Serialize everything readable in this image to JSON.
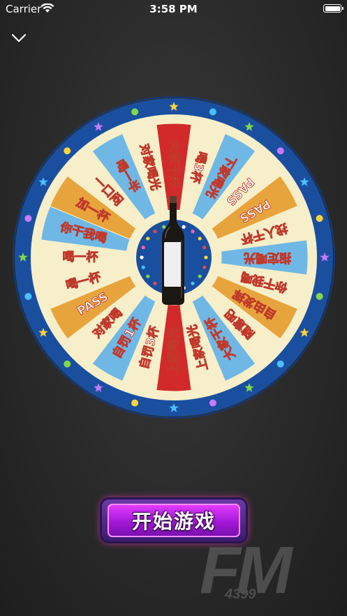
{
  "status_bar": {
    "carrier": "Carrier",
    "time": "3:58 PM",
    "battery_level": 1.0
  },
  "wheel": {
    "segments": [
      {
        "text": "大家干杯",
        "color": "#d22a2a"
      },
      {
        "text": "喝3杯",
        "color": "#f6efc9"
      },
      {
        "text": "下家喝光",
        "color": "#6fb8e6"
      },
      {
        "text": "PASS",
        "color": "#f6efc9"
      },
      {
        "text": "PASS",
        "color": "#e8a43c"
      },
      {
        "text": "找人干杯",
        "color": "#f6efc9"
      },
      {
        "text": "指定喝光",
        "color": "#6fb8e6"
      },
      {
        "text": "你干我喝",
        "color": "#f6efc9"
      },
      {
        "text": "自由发挥",
        "color": "#e8a43c"
      },
      {
        "text": "随意吧",
        "color": "#f6efc9"
      },
      {
        "text": "大家干杯",
        "color": "#6fb8e6"
      },
      {
        "text": "上家喝光",
        "color": "#f6efc9"
      },
      {
        "text": "上家喝光",
        "color": "#d22a2a"
      },
      {
        "text": "自罚3杯",
        "color": "#f6efc9"
      },
      {
        "text": "自罚1杯",
        "color": "#6fb8e6"
      },
      {
        "text": "对家喝",
        "color": "#f6efc9"
      },
      {
        "text": "PASS",
        "color": "#e8a43c"
      },
      {
        "text": "喝一杯",
        "color": "#f6efc9"
      },
      {
        "text": "喝一杯",
        "color": "#f6efc9"
      },
      {
        "text": "你干我喝",
        "color": "#6fb8e6"
      },
      {
        "text": "加一杯",
        "color": "#e8a43c"
      },
      {
        "text": "一口闷",
        "color": "#f6efc9"
      },
      {
        "text": "喝一半",
        "color": "#6fb8e6"
      },
      {
        "text": "对家喝光",
        "color": "#f6efc9"
      }
    ],
    "rim_color": "#1a4fa0",
    "inner_color": "#f6efc9"
  },
  "start_button": {
    "label": "开始游戏"
  },
  "watermark": {
    "brand": "FM",
    "number": "4399"
  }
}
